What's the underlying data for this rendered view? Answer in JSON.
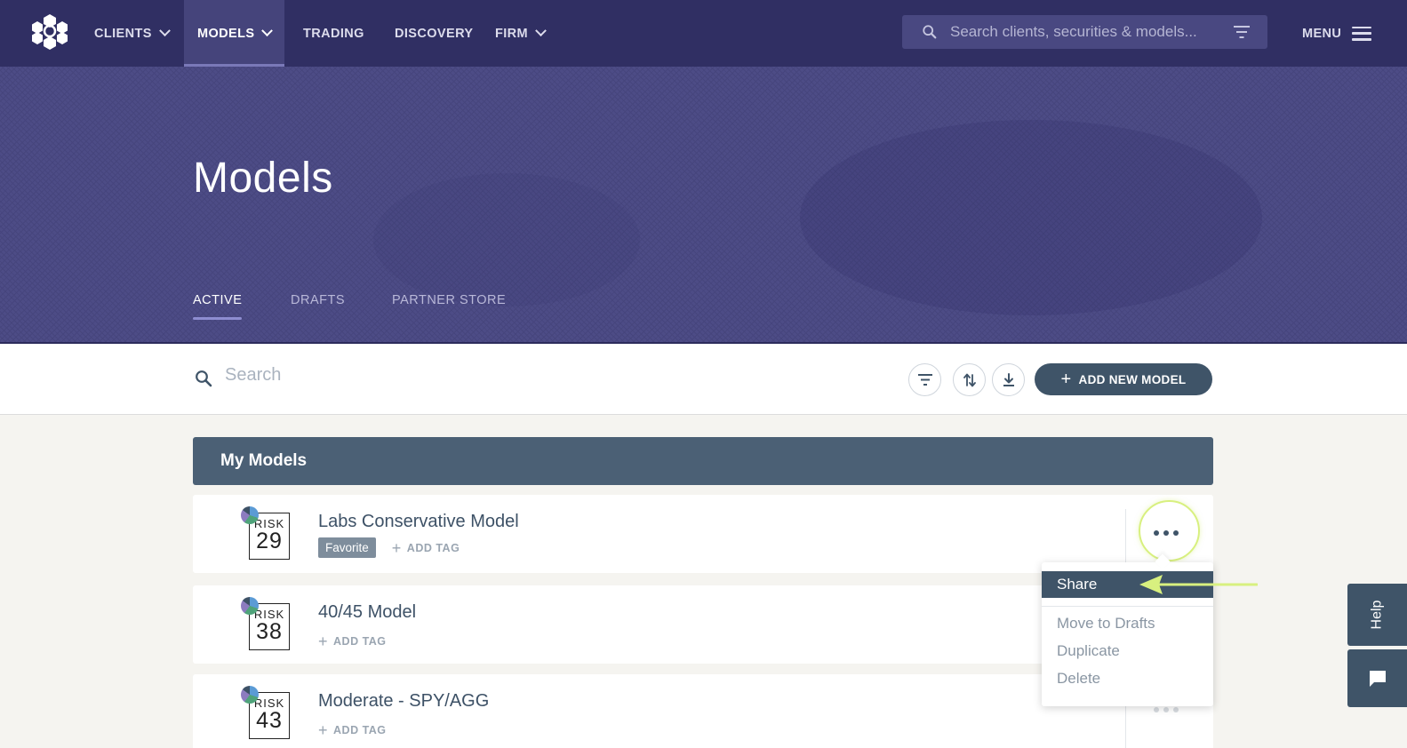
{
  "nav": {
    "items": [
      {
        "label": "CLIENTS",
        "has_dropdown": true,
        "active": false
      },
      {
        "label": "MODELS",
        "has_dropdown": true,
        "active": true
      },
      {
        "label": "TRADING",
        "has_dropdown": false,
        "active": false
      },
      {
        "label": "DISCOVERY",
        "has_dropdown": false,
        "active": false
      },
      {
        "label": "FIRM",
        "has_dropdown": true,
        "active": false
      }
    ],
    "search_placeholder": "Search clients, securities & models...",
    "menu_label": "MENU"
  },
  "hero": {
    "title": "Models",
    "tabs": [
      {
        "label": "ACTIVE",
        "active": true
      },
      {
        "label": "DRAFTS",
        "active": false
      },
      {
        "label": "PARTNER STORE",
        "active": false
      }
    ]
  },
  "toolbar": {
    "search_placeholder": "Search",
    "add_button_label": "ADD NEW MODEL"
  },
  "group": {
    "title": "My Models"
  },
  "models": [
    {
      "name": "Labs Conservative Model",
      "risk_label": "RISK",
      "risk": "29",
      "tags": [
        "Favorite"
      ],
      "add_tag_label": "ADD TAG"
    },
    {
      "name": "40/45 Model",
      "risk_label": "RISK",
      "risk": "38",
      "tags": [],
      "add_tag_label": "ADD TAG"
    },
    {
      "name": "Moderate - SPY/AGG",
      "risk_label": "RISK",
      "risk": "43",
      "tags": [],
      "add_tag_label": "ADD TAG"
    }
  ],
  "row_menu": {
    "items": [
      "Share",
      "Move to Drafts",
      "Duplicate",
      "Delete"
    ],
    "highlighted": "Share"
  },
  "help": {
    "label": "Help"
  },
  "colors": {
    "nav_bg": "#302f63",
    "hero_bg": "#4d4c86",
    "primary": "#3f5468",
    "annotation": "#d8f07f"
  }
}
